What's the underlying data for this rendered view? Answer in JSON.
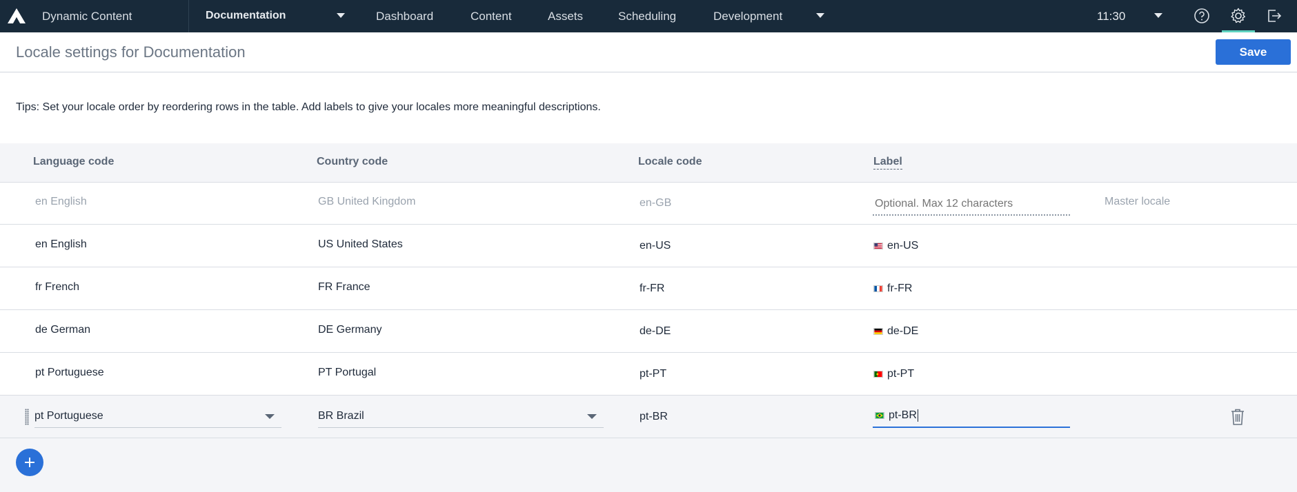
{
  "nav": {
    "app_name": "Dynamic Content",
    "hub": "Documentation",
    "items": [
      "Dashboard",
      "Content",
      "Assets",
      "Scheduling",
      "Development"
    ],
    "time": "11:30",
    "icons": [
      "help-icon",
      "settings-icon",
      "logout-icon"
    ]
  },
  "header": {
    "title": "Locale settings for Documentation",
    "save_label": "Save"
  },
  "tips": "Tips: Set your locale order by reordering rows in the table. Add labels to give your locales more meaningful descriptions.",
  "table": {
    "columns": {
      "language": "Language code",
      "country": "Country code",
      "locale": "Locale code",
      "label": "Label"
    },
    "master": {
      "language": "en English",
      "country": "GB United Kingdom",
      "locale": "en-GB",
      "label_placeholder": "Optional. Max 12 characters",
      "note": "Master locale"
    },
    "rows": [
      {
        "language": "en English",
        "country": "US United States",
        "locale": "en-US",
        "label": "en-US"
      },
      {
        "language": "fr French",
        "country": "FR France",
        "locale": "fr-FR",
        "label": "fr-FR"
      },
      {
        "language": "de German",
        "country": "DE Germany",
        "locale": "de-DE",
        "label": "de-DE"
      },
      {
        "language": "pt Portuguese",
        "country": "PT Portugal",
        "locale": "pt-PT",
        "label": "pt-PT"
      }
    ],
    "editing": {
      "language": "pt Portuguese",
      "country": "BR Brazil",
      "locale": "pt-BR",
      "label": "pt-BR"
    }
  },
  "colors": {
    "nav_bg": "#182a3a",
    "accent": "#2a70d8",
    "active_indicator": "#5fd3c0"
  }
}
